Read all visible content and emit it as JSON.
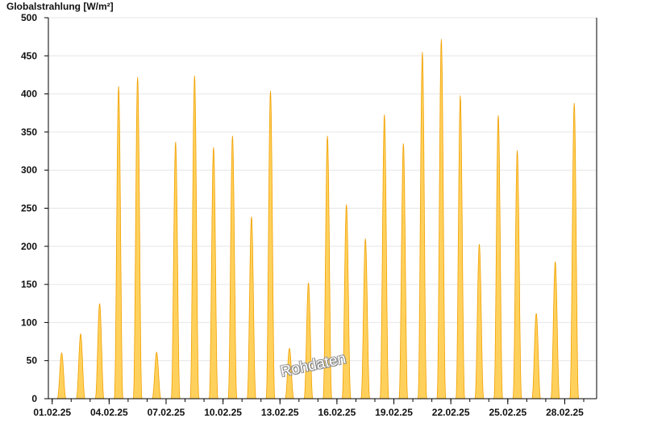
{
  "chart_data": {
    "type": "area",
    "title": "",
    "ylabel": "Globalstrahlung [W/m²]",
    "xlabel": "",
    "ylim": [
      0,
      500
    ],
    "yticks": [
      0,
      50,
      100,
      150,
      200,
      250,
      300,
      350,
      400,
      450,
      500
    ],
    "xlim": [
      "01.02.25",
      "29.02.25"
    ],
    "xticks": [
      "01.02.25",
      "04.02.25",
      "07.02.25",
      "10.02.25",
      "13.02.25",
      "16.02.25",
      "19.02.25",
      "22.02.25",
      "25.02.25",
      "28.02.25"
    ],
    "grid": "horizontal",
    "fill_color": "#ffd15c",
    "line_color": "#f0a000",
    "series": [
      {
        "days": [
          "01.02.25",
          "02.02.25",
          "03.02.25",
          "04.02.25",
          "05.02.25",
          "06.02.25",
          "07.02.25",
          "08.02.25",
          "09.02.25",
          "10.02.25",
          "11.02.25",
          "12.02.25",
          "13.02.25",
          "14.02.25",
          "15.02.25",
          "16.02.25",
          "17.02.25",
          "18.02.25",
          "19.02.25",
          "20.02.25",
          "21.02.25",
          "22.02.25",
          "23.02.25",
          "24.02.25",
          "25.02.25",
          "26.02.25",
          "27.02.25",
          "28.02.25"
        ],
        "daily_peak": [
          60,
          85,
          125,
          410,
          422,
          61,
          337,
          424,
          330,
          345,
          239,
          404,
          66,
          152,
          345,
          255,
          210,
          373,
          335,
          455,
          472,
          398,
          203,
          372,
          326,
          112,
          180,
          388
        ]
      }
    ]
  },
  "watermark": "Rohdaten"
}
